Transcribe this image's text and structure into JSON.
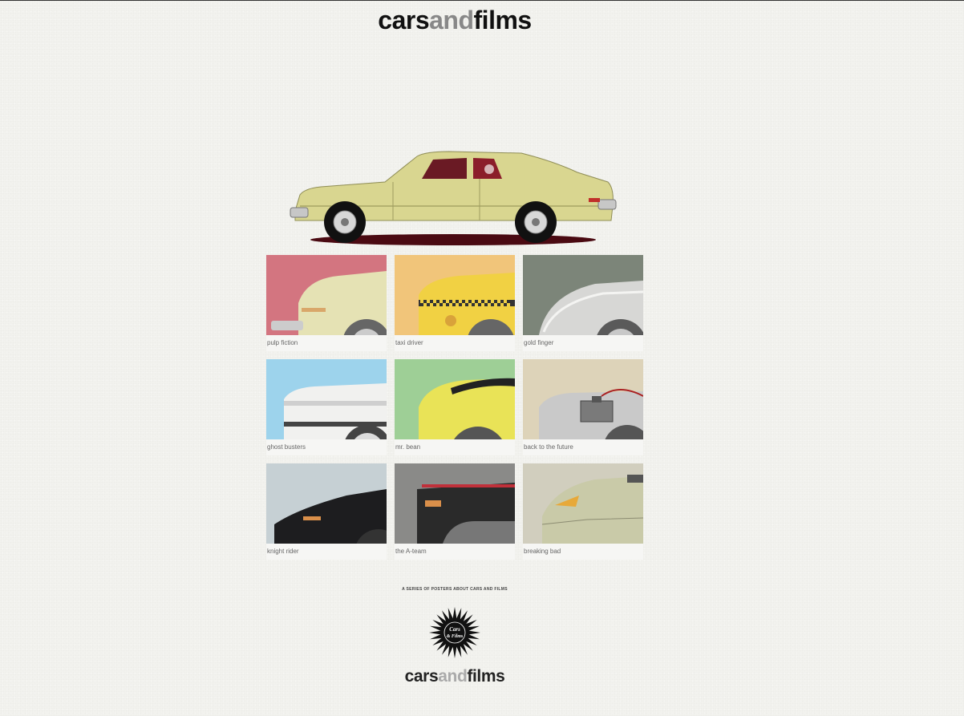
{
  "header": {
    "logo": {
      "part1": "cars",
      "part2": "and",
      "part3": "films"
    }
  },
  "hero": {
    "car_color": "#d9d690"
  },
  "posters": [
    {
      "title": "pulp fiction",
      "bg": "#d37580"
    },
    {
      "title": "taxi driver",
      "bg": "#f1c57a"
    },
    {
      "title": "gold finger",
      "bg": "#7c8579"
    },
    {
      "title": "ghost busters",
      "bg": "#9dd3ec"
    },
    {
      "title": "mr. bean",
      "bg": "#9ecf96"
    },
    {
      "title": "back to the future",
      "bg": "#ddd3b9"
    },
    {
      "title": "knight rider",
      "bg": "#c6d0d4"
    },
    {
      "title": "the A-team",
      "bg": "#8a8a88"
    },
    {
      "title": "breaking bad",
      "bg": "#d1cebe"
    }
  ],
  "footer": {
    "tagline": "A SERIES OF POSTERS ABOUT CARS AND FILMS",
    "badge_text": {
      "line1": "Cars",
      "line2": "& Films"
    },
    "logo": {
      "part1": "cars",
      "part2": "and",
      "part3": "films"
    }
  }
}
